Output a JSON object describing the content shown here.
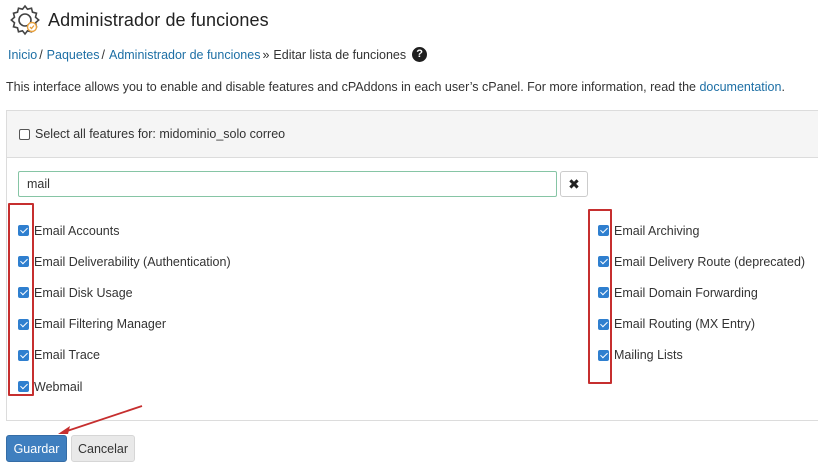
{
  "header": {
    "title": "Administrador de funciones",
    "icon": "feature-manager-gear-icon"
  },
  "breadcrumb": {
    "items": [
      {
        "label": "Inicio"
      },
      {
        "label": "Paquetes"
      },
      {
        "label": "Administrador de funciones"
      }
    ],
    "separators": [
      "/",
      "/",
      "»"
    ],
    "current": "Editar lista de funciones",
    "help_icon": "?"
  },
  "intro": {
    "text": "This interface allows you to enable and disable features and cPAddons in each user’s cPanel. For more information, read the ",
    "link": "documentation",
    "suffix": "."
  },
  "select_all": {
    "label": "Select all features for: midominio_solo correo",
    "checked": false
  },
  "search": {
    "value": "mail",
    "clear_icon": "✖"
  },
  "features_left": [
    {
      "label": "Email Accounts",
      "checked": true
    },
    {
      "label": "Email Deliverability (Authentication)",
      "checked": true
    },
    {
      "label": "Email Disk Usage",
      "checked": true
    },
    {
      "label": "Email Filtering Manager",
      "checked": true
    },
    {
      "label": "Email Trace",
      "checked": true
    },
    {
      "label": "Webmail",
      "checked": true
    }
  ],
  "features_right": [
    {
      "label": "Email Archiving",
      "checked": true
    },
    {
      "label": "Email Delivery Route (deprecated)",
      "checked": true
    },
    {
      "label": "Email Domain Forwarding",
      "checked": true
    },
    {
      "label": "Email Routing (MX Entry)",
      "checked": true
    },
    {
      "label": "Mailing Lists",
      "checked": true
    }
  ],
  "buttons": {
    "save": "Guardar",
    "cancel": "Cancelar"
  },
  "colors": {
    "link": "#1d6fa5",
    "checkbox": "#2f7fcf",
    "primary_button": "#3f7fbf",
    "annotation": "#c62f2f"
  }
}
